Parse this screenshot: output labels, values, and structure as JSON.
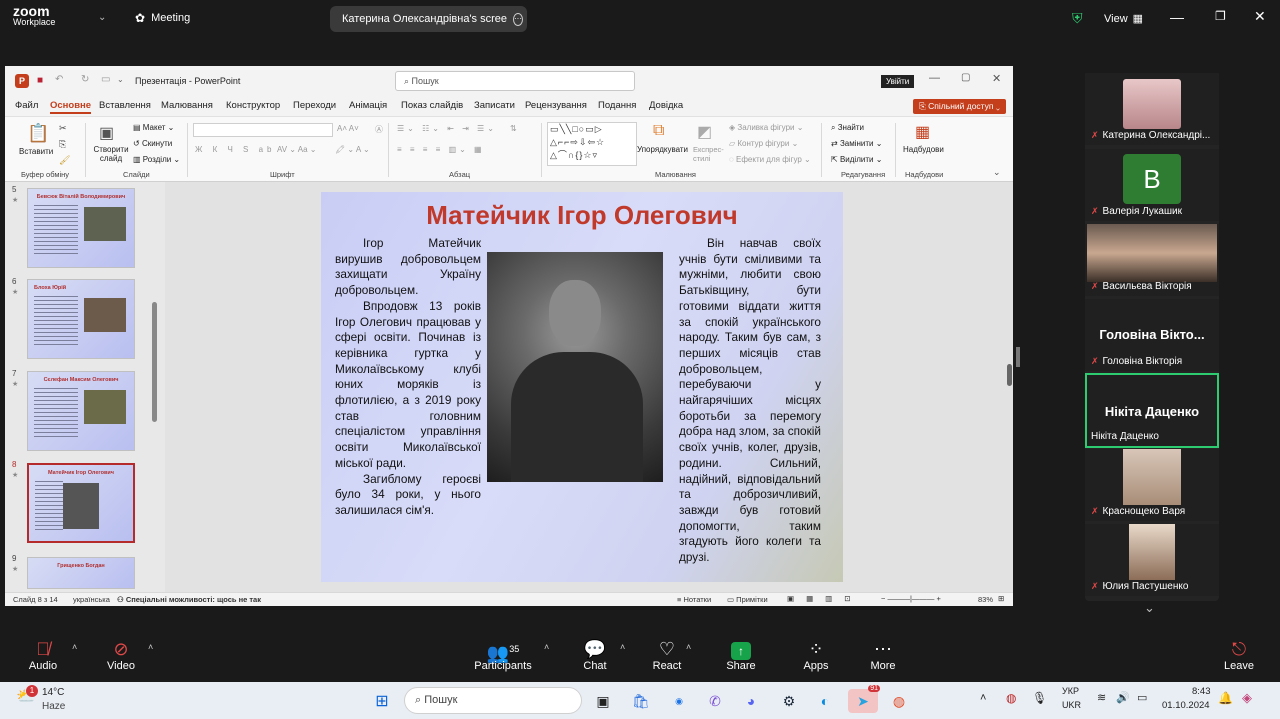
{
  "zoom": {
    "logo_line1": "zoom",
    "logo_line2": "Workplace",
    "meeting_label": "Meeting",
    "share_pill_text": "Катерина Олександрівна's scree",
    "view_label": "View",
    "controls": {
      "audio": "Audio",
      "video": "Video",
      "participants": "Participants",
      "participants_count": "35",
      "chat": "Chat",
      "react": "React",
      "share": "Share",
      "apps": "Apps",
      "more": "More",
      "leave": "Leave"
    }
  },
  "ppt": {
    "title": "Презентація  -  PowerPoint",
    "search_placeholder": "Пошук",
    "signin": "Увійти",
    "share_btn": "Спільний доступ",
    "menu": [
      "Файл",
      "Основне",
      "Вставлення",
      "Малювання",
      "Конструктор",
      "Переходи",
      "Анімація",
      "Показ слайдів",
      "Записати",
      "Рецензування",
      "Подання",
      "Довідка"
    ],
    "ribbon": {
      "paste": "Вставити",
      "clipboard": "Буфер обміну",
      "new_slide": "Створити слайд",
      "layout": "Макет",
      "reset": "Скинути",
      "sections": "Розділи",
      "slides": "Слайди",
      "font": "Шрифт",
      "paragraph": "Абзац",
      "arrange": "Упорядкувати",
      "quick_styles": "Експрес-стилі",
      "shape_fill": "Заливка фігури",
      "shape_outline": "Контур фігури",
      "shape_effects": "Ефекти для фігур",
      "drawing": "Малювання",
      "find": "Знайти",
      "replace": "Замінити",
      "select": "Виділити",
      "editing": "Редагування",
      "addins": "Надбудови",
      "addins_group": "Надбудови"
    },
    "thumbs": [
      {
        "num": "5",
        "title": "Бевсюк Віталій Володимирович"
      },
      {
        "num": "6",
        "title": "Блоха Юрій"
      },
      {
        "num": "7",
        "title": "Сєлефан Максим Олегович"
      },
      {
        "num": "8",
        "title": "Матейчик Ігор Олегович"
      },
      {
        "num": "9",
        "title": "Грищенко Богдан"
      }
    ],
    "slide": {
      "title": "Матейчик Ігор Олегович",
      "left_p1": "Ігор Матейчик вирушив добровольцем захищати Україну добровольцем.",
      "left_p2": "Впродовж 13 років Ігор Олегович працював у сфері освіти. Починав із керівника гуртка у Миколаївському клубі юних моряків із флотилією, а з 2019 року став головним спеціалістом управління освіти Миколаївської міської ради.",
      "left_p3": "Загиблому героєві було 34 роки, у нього залишилася сім'я.",
      "right_p1": "Він навчав своїх учнів бути сміливими та мужніми, любити свою Батьківщину, бути готовими віддати життя за спокій українського народу. Таким був сам, з перших місяців став добровольцем, перебуваючи у найгарячіших місцях боротьби за перемогу добра над злом, за спокій своїх учнів, колег, друзів, родини. Сильний, надійний, відповідальний та доброзичливий, завжди був готовий допомогти, таким згадують його колеги та друзі."
    },
    "status": {
      "slide_of": "Слайд 8 з 14",
      "language": "українська",
      "accessibility": "Спеціальні можливості: щось не так",
      "notes": "Нотатки",
      "comments": "Примітки",
      "zoom": "83%"
    }
  },
  "participants": [
    {
      "name": "Катерина Олександрі...",
      "type": "video"
    },
    {
      "name": "Валерія Лукашик",
      "type": "initial",
      "initial": "B"
    },
    {
      "name": "Васильєва Вікторія",
      "type": "video"
    },
    {
      "name": "Головіна Вікторія",
      "type": "bigname",
      "big": "Головіна Вікто..."
    },
    {
      "name": "Нікіта Даценко",
      "type": "bigname",
      "big": "Нікіта Даценко"
    },
    {
      "name": "Краснощеко Варя",
      "type": "video"
    },
    {
      "name": "Юлия Пастушенко",
      "type": "video"
    }
  ],
  "taskbar": {
    "temp": "14°C",
    "weather": "Haze",
    "weather_badge": "1",
    "search": "Пошук",
    "lang1": "УКР",
    "lang2": "UKR",
    "time": "8:43",
    "date": "01.10.2024",
    "telegram_badge": "91"
  },
  "colors": {
    "ppt_accent": "#c43e1c",
    "slide_title": "#c0392b",
    "active_speaker": "#2ecc71",
    "zoom_share": "#16a34a"
  }
}
